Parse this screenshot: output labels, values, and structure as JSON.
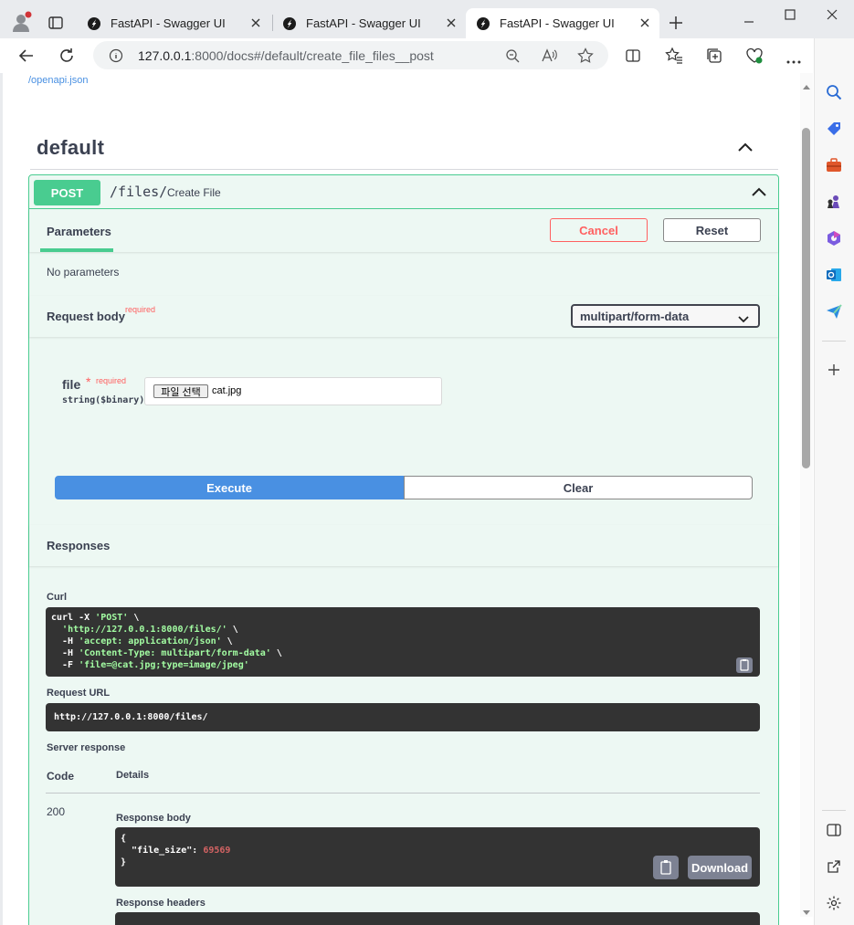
{
  "browser": {
    "tabs": [
      {
        "title": "FastAPI - Swagger UI",
        "active": false
      },
      {
        "title": "FastAPI - Swagger UI",
        "active": false
      },
      {
        "title": "FastAPI - Swagger UI",
        "active": true
      }
    ],
    "url_host": "127.0.0.1",
    "url_rest": ":8000/docs#/default/create_file_files__post"
  },
  "page": {
    "openapi_link": "/openapi.json",
    "section_title": "default",
    "operation": {
      "method": "POST",
      "path": "/files/",
      "summary": "Create File"
    },
    "parameters_tab": "Parameters",
    "cancel_label": "Cancel",
    "reset_label": "Reset",
    "no_parameters": "No parameters",
    "request_body_label": "Request body",
    "required_label": "required",
    "content_type": "multipart/form-data",
    "file_field": {
      "name": "file",
      "star": "*",
      "required": "required",
      "type": "string($binary)",
      "choose_label": "파일 선택",
      "selected_file": "cat.jpg"
    },
    "execute_label": "Execute",
    "clear_label": "Clear",
    "responses_label": "Responses",
    "curl_label": "Curl",
    "curl_lines": [
      {
        "plain": "curl -X ",
        "str": "'POST'",
        "tail": " \\"
      },
      {
        "plain": "  ",
        "str": "'http://127.0.0.1:8000/files/'",
        "tail": " \\"
      },
      {
        "plain": "  -H ",
        "str": "'accept: application/json'",
        "tail": " \\"
      },
      {
        "plain": "  -H ",
        "str": "'Content-Type: multipart/form-data'",
        "tail": " \\"
      },
      {
        "plain": "  -F ",
        "str": "'file=@cat.jpg;type=image/jpeg'",
        "tail": ""
      }
    ],
    "request_url_label": "Request URL",
    "request_url": "http://127.0.0.1:8000/files/",
    "server_response_label": "Server response",
    "code_col": "Code",
    "details_col": "Details",
    "status_code": "200",
    "response_body_label": "Response body",
    "response_body": {
      "open": "{",
      "key": "  \"file_size\": ",
      "value": "69569",
      "close": "}"
    },
    "download_label": "Download",
    "response_headers_label": "Response headers"
  },
  "colors": {
    "post_green": "#49cc90",
    "execute_blue": "#4990e2",
    "cancel_red": "#ff6060"
  }
}
